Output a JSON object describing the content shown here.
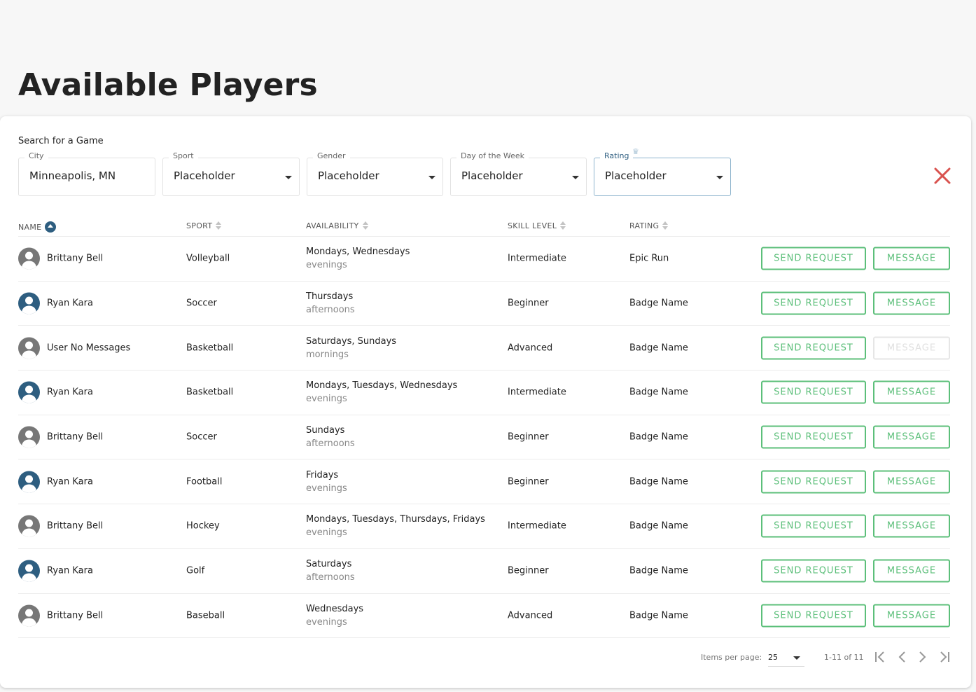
{
  "page": {
    "title": "Available Players"
  },
  "search": {
    "label": "Search for a Game",
    "city": {
      "label": "City",
      "value": "Minneapolis, MN"
    },
    "sport": {
      "label": "Sport",
      "value": "Placeholder"
    },
    "gender": {
      "label": "Gender",
      "value": "Placeholder"
    },
    "day": {
      "label": "Day of the Week",
      "value": "Placeholder"
    },
    "rating": {
      "label": "Rating",
      "value": "Placeholder"
    },
    "icons": {
      "clear": "close-icon",
      "rating_badge": "crown-icon"
    }
  },
  "table": {
    "columns": [
      "NAME",
      "SPORT",
      "AVAILABILITY",
      "SKILL LEVEL",
      "RATING"
    ],
    "send_label": "SEND REQUEST",
    "message_label": "MESSAGE",
    "rows": [
      {
        "name": "Brittany Bell",
        "avatar": "gray",
        "sport": "Volleyball",
        "days": "Mondays, Wednesdays",
        "time": "evenings",
        "skill": "Intermediate",
        "rating": "Epic Run",
        "message_enabled": true
      },
      {
        "name": "Ryan Kara",
        "avatar": "blue",
        "sport": "Soccer",
        "days": "Thursdays",
        "time": "afternoons",
        "skill": "Beginner",
        "rating": "Badge Name",
        "message_enabled": true
      },
      {
        "name": "User No Messages",
        "avatar": "gray",
        "sport": "Basketball",
        "days": "Saturdays, Sundays",
        "time": "mornings",
        "skill": "Advanced",
        "rating": "Badge Name",
        "message_enabled": false
      },
      {
        "name": "Ryan Kara",
        "avatar": "blue",
        "sport": "Basketball",
        "days": "Mondays, Tuesdays, Wednesdays",
        "time": "evenings",
        "skill": "Intermediate",
        "rating": "Badge Name",
        "message_enabled": true
      },
      {
        "name": "Brittany Bell",
        "avatar": "gray",
        "sport": "Soccer",
        "days": "Sundays",
        "time": "afternoons",
        "skill": "Beginner",
        "rating": "Badge Name",
        "message_enabled": true
      },
      {
        "name": "Ryan Kara",
        "avatar": "blue",
        "sport": "Football",
        "days": "Fridays",
        "time": "evenings",
        "skill": "Beginner",
        "rating": "Badge Name",
        "message_enabled": true
      },
      {
        "name": "Brittany Bell",
        "avatar": "gray",
        "sport": "Hockey",
        "days": "Mondays, Tuesdays, Thursdays, Fridays",
        "time": "evenings",
        "skill": "Intermediate",
        "rating": "Badge Name",
        "message_enabled": true
      },
      {
        "name": "Ryan Kara",
        "avatar": "blue",
        "sport": "Golf",
        "days": "Saturdays",
        "time": "afternoons",
        "skill": "Beginner",
        "rating": "Badge Name",
        "message_enabled": true
      },
      {
        "name": "Brittany Bell",
        "avatar": "gray",
        "sport": "Baseball",
        "days": "Wednesdays",
        "time": "evenings",
        "skill": "Advanced",
        "rating": "Badge Name",
        "message_enabled": true
      }
    ]
  },
  "pagination": {
    "items_per_page_label": "Items per page:",
    "items_per_page_value": "25",
    "range": "1-11 of 11",
    "icons": [
      "first-page-icon",
      "previous-page-icon",
      "next-page-icon",
      "last-page-icon"
    ]
  },
  "colors": {
    "accent_green": "#5cbf7a",
    "primary_blue": "#2e5e80",
    "danger_red": "#d9534f"
  }
}
